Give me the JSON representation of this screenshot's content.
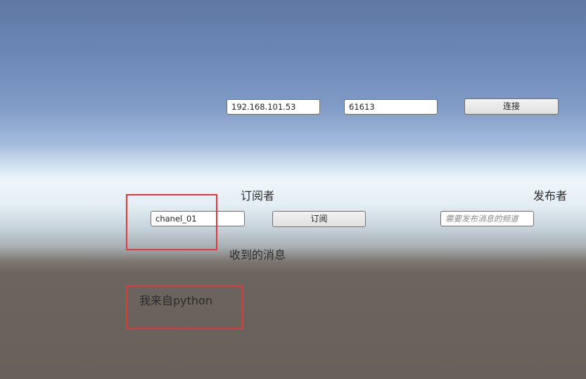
{
  "connection": {
    "ip_value": "192.168.101.53",
    "port_value": "61613",
    "connect_label": "连接"
  },
  "subscriber": {
    "title": "订阅者",
    "channel_value": "chanel_01",
    "subscribe_label": "订阅",
    "received_title": "收到的消息",
    "received_message": "我来自python"
  },
  "publisher": {
    "title": "发布者",
    "channel_placeholder": "需要发布消息的频道"
  },
  "colors": {
    "highlight_box": "#e23a3a"
  }
}
